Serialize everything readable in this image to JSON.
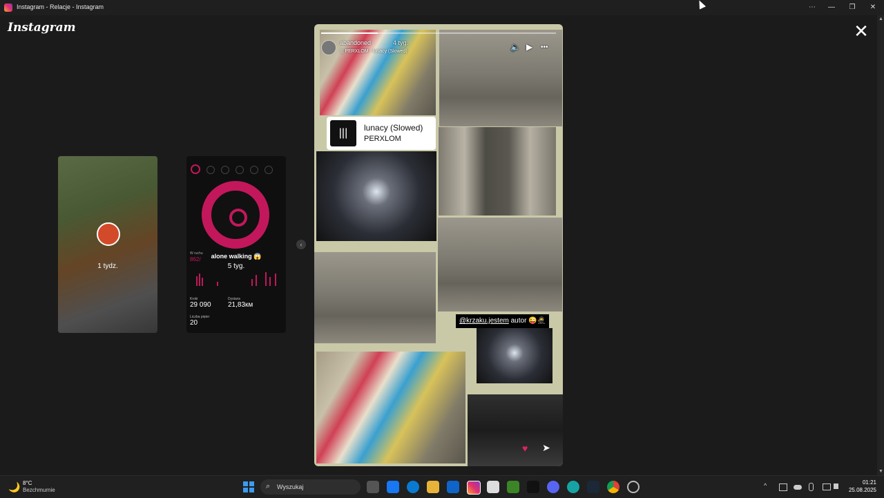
{
  "window": {
    "title": "Instagram - Relacje - Instagram",
    "controls": {
      "more": "⋯",
      "minimize": "—",
      "maximize": "❐",
      "close": "✕"
    }
  },
  "app": {
    "logo": "Instagram",
    "close": "✕"
  },
  "side_stories": [
    {
      "time": "1 tydz."
    },
    {
      "name": "alone walking 😱",
      "time": "5 tyg.",
      "stats": {
        "stat1_label": "W ruchu",
        "stat1_value": "862/",
        "steps_label": "Kroki",
        "steps_value": "29 090",
        "distance_label": "Dystans",
        "distance_value": "21,83км",
        "floors_label": "Liczba pięter",
        "floors_value": "20"
      }
    }
  ],
  "prev_button": "‹",
  "story": {
    "author": "abandoned",
    "time_ago": "4 tyg.",
    "music_line": "|||  PERXLOM · lunacy (Slowed)",
    "progress": 0.24,
    "controls": {
      "mute": "🔈",
      "play": "▶",
      "more": "•••"
    },
    "music_sticker": {
      "icon": "|||",
      "song": "lunacy (Slowed)",
      "artist": "PERXLOM"
    },
    "mention": {
      "handle": "@krzaku.jestem",
      "text": " autor 😜🥷"
    },
    "actions": {
      "like": "♥",
      "share": "➤"
    }
  },
  "taskbar": {
    "weather": {
      "temp": "8°C",
      "condition": "Bezchmurnie",
      "icon": "🌙"
    },
    "search_placeholder": "Wyszukaj",
    "search_icon": "⌕",
    "tray_chevron": "^",
    "time": "01:21",
    "date": "25.08.2025"
  },
  "colors": {
    "accent": "#c2185b",
    "heart": "#e0245e",
    "windows_blue": "#3b9cf0"
  }
}
